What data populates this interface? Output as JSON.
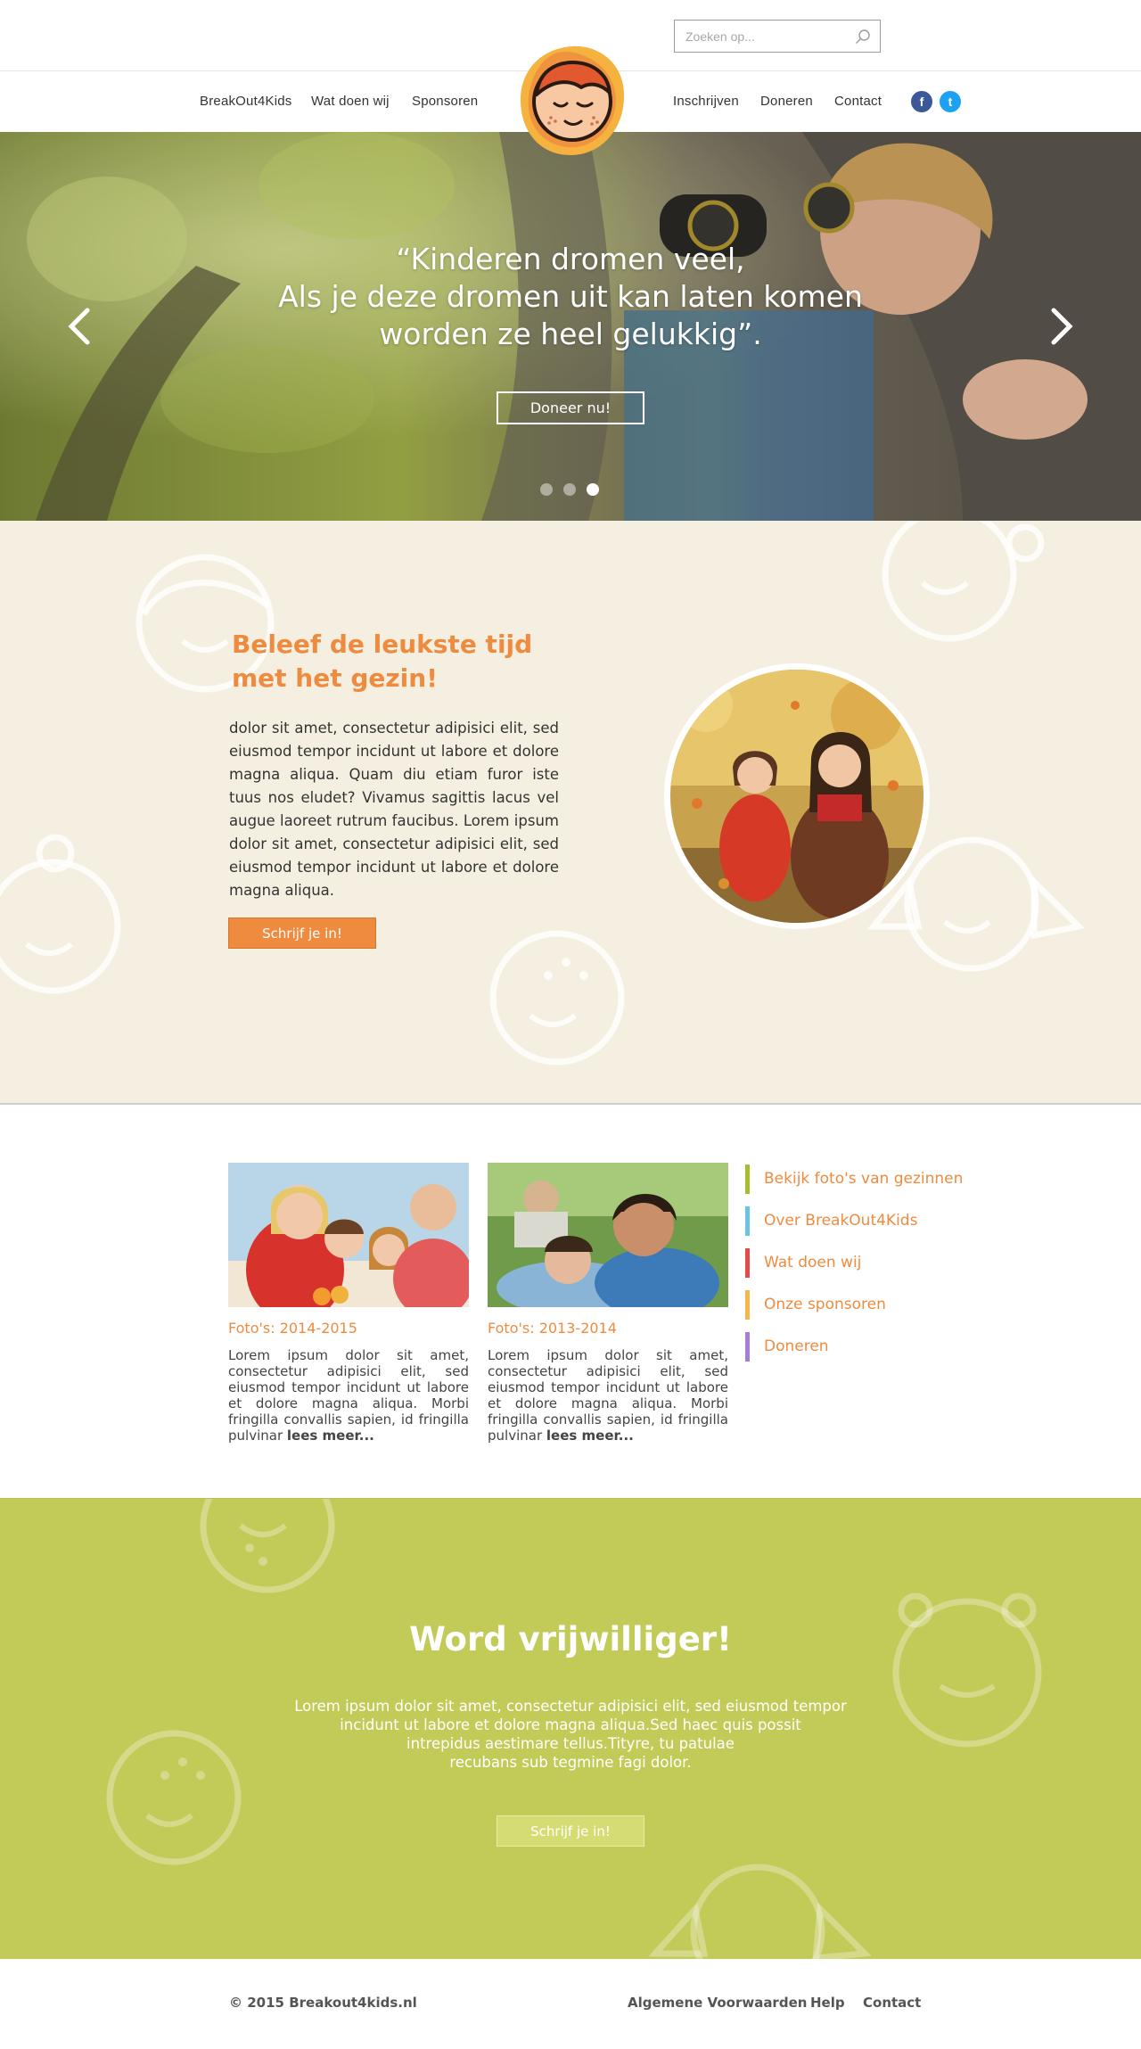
{
  "search": {
    "placeholder": "Zoeken op..."
  },
  "nav": {
    "left": [
      "BreakOut4Kids",
      "Wat doen wij",
      "Sponsoren"
    ],
    "right": [
      "Inschrijven",
      "Doneren",
      "Contact"
    ],
    "social": [
      "f",
      "t"
    ]
  },
  "hero": {
    "quote_lines": [
      "“Kinderen dromen veel,",
      "Als je deze dromen uit kan laten komen",
      "worden ze heel gelukkig”."
    ],
    "button": "Doneer nu!",
    "slides": 3,
    "active_slide": 3
  },
  "about": {
    "title": "Beleef de leukste tijd met het gezin!",
    "text": "dolor sit amet, consectetur adipisici elit, sed eiusmod tempor incidunt ut labore et dolore magna aliqua. Quam diu etiam furor iste tuus nos eludet? Vivamus sagittis lacus vel augue laoreet rutrum faucibus. Lorem ipsum dolor sit amet, consectetur adipisici elit, sed eiusmod tempor incidunt ut labore et dolore magna aliqua.",
    "button": "Schrijf je in!"
  },
  "photos": {
    "cards": [
      {
        "title": "Foto's: 2014-2015",
        "text": "Lorem ipsum dolor sit amet, consectetur adipisici elit, sed eiusmod tempor incidunt ut labore et dolore magna aliqua. Morbi fringilla convallis sapien, id fringilla pulvinar",
        "more": "lees meer..."
      },
      {
        "title": "Foto's: 2013-2014",
        "text": "Lorem ipsum dolor sit amet, consectetur adipisici elit, sed eiusmod tempor incidunt ut labore et dolore magna aliqua. Morbi fringilla convallis sapien, id fringilla pulvinar",
        "more": "lees meer..."
      }
    ],
    "links": [
      {
        "label": "Bekijk foto's van gezinnen",
        "color": "#a9bc2e"
      },
      {
        "label": "Over BreakOut4Kids",
        "color": "#6cc3e0"
      },
      {
        "label": "Wat doen wij",
        "color": "#e04c4c"
      },
      {
        "label": "Onze sponsoren",
        "color": "#f2b84b"
      },
      {
        "label": "Doneren",
        "color": "#a57fd4"
      }
    ]
  },
  "volunteer": {
    "title": "Word vrijwilliger!",
    "lines": [
      "Lorem ipsum dolor sit amet, consectetur adipisici elit, sed eiusmod tempor",
      "incidunt ut labore et dolore magna aliqua.Sed haec quis possit",
      "intrepidus aestimare tellus.Tityre, tu patulae",
      "recubans sub tegmine fagi  dolor."
    ],
    "button": "Schrijf je in!"
  },
  "footer": {
    "copyright": "© 2015 Breakout4kids.nl",
    "links": [
      "Algemene Voorwaarden",
      "Help",
      "Contact"
    ]
  },
  "colors": {
    "accent": "#ee8b3f",
    "cream": "#f5efe1",
    "green": "#c2cb58"
  }
}
